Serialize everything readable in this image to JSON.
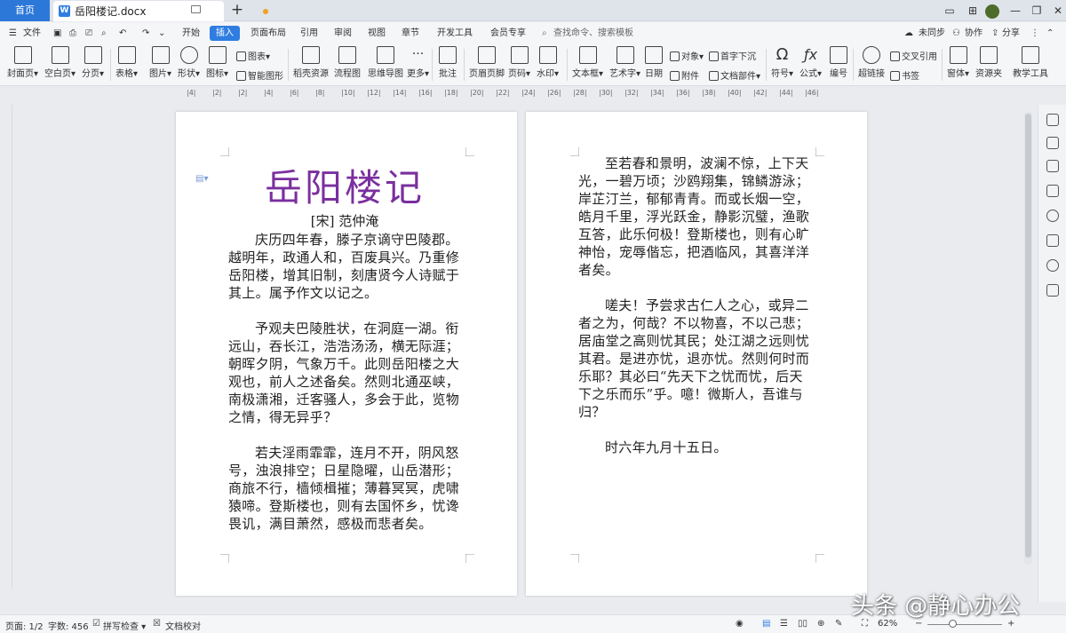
{
  "tabs": {
    "home": "首页",
    "doc_name": "岳阳楼记.docx"
  },
  "menu": {
    "file": "文件",
    "start": "开始",
    "insert": "插入",
    "layout": "页面布局",
    "reference": "引用",
    "review": "审阅",
    "view": "视图",
    "chapter": "章节",
    "devtools": "开发工具",
    "member": "会员专享",
    "search_placeholder": "查找命令、搜索模板",
    "sync": "未同步",
    "collab": "协作",
    "share": "分享"
  },
  "ribbon": {
    "cover": "封面页",
    "blank": "空白页",
    "pagebreak": "分页",
    "table": "表格",
    "picture": "图片",
    "shape": "形状",
    "icon": "图标",
    "chart": "图表",
    "smartart": "智能图形",
    "shell": "稻壳资源",
    "flowchart": "流程图",
    "mindmap": "思维导图",
    "more": "更多",
    "comment": "批注",
    "header_footer": "页眉页脚",
    "page_num": "页码",
    "watermark": "水印",
    "textbox": "文本框",
    "wordart": "艺术字",
    "date": "日期",
    "object": "对象",
    "dropcap": "首字下沉",
    "attach": "附件",
    "docparts": "文档部件",
    "symbol": "符号",
    "formula": "公式",
    "numbering": "编号",
    "crossref": "交叉引用",
    "hyperlink": "超链接",
    "bookmark": "书签",
    "window": "窗体",
    "resource": "资源夹",
    "teach": "教学工具"
  },
  "ruler_marks": [
    "4",
    "2",
    "2",
    "4",
    "6",
    "8",
    "10",
    "12",
    "14",
    "16",
    "18",
    "20",
    "22",
    "24",
    "26",
    "28",
    "30",
    "32",
    "34",
    "36",
    "38",
    "40",
    "42",
    "44",
    "46"
  ],
  "page1": {
    "title": "岳阳楼记",
    "author": "[宋] 范仲淹",
    "para1": "庆历四年春，滕子京谪守巴陵郡。越明年，政通人和，百废具兴。乃重修岳阳楼，增其旧制，刻唐贤今人诗赋于其上。属予作文以记之。",
    "para2": "予观夫巴陵胜状，在洞庭一湖。衔远山，吞长江，浩浩汤汤，横无际涯；朝晖夕阴，气象万千。此则岳阳楼之大观也，前人之述备矣。然则北通巫峡，南极潇湘，迁客骚人，多会于此，览物之情，得无异乎？",
    "para3": "若夫淫雨霏霏，连月不开，阴风怒号，浊浪排空；日星隐曜，山岳潜形；商旅不行，樯倾楫摧；薄暮冥冥，虎啸猿啼。登斯楼也，则有去国怀乡，忧谗畏讥，满目萧然，感极而悲者矣。"
  },
  "page2": {
    "para1": "至若春和景明，波澜不惊，上下天光，一碧万顷；沙鸥翔集，锦鳞游泳；岸芷汀兰，郁郁青青。而或长烟一空，皓月千里，浮光跃金，静影沉璧，渔歌互答，此乐何极！登斯楼也，则有心旷神怡，宠辱偕忘，把酒临风，其喜洋洋者矣。",
    "para2": "嗟夫！予尝求古仁人之心，或异二者之为，何哉？不以物喜，不以己悲；居庙堂之高则忧其民；处江湖之远则忧其君。是进亦忧，退亦忧。然则何时而乐耶？其必曰“先天下之忧而忧，后天下之乐而乐”乎。噫！微斯人，吾谁与归？",
    "para3": "时六年九月十五日。"
  },
  "status": {
    "page": "页面: 1/2",
    "words": "字数: 456",
    "spellcheck": "拼写检查",
    "proofread": "文档校对",
    "zoom": "62%"
  },
  "watermark_text": "头条 @静心办公"
}
